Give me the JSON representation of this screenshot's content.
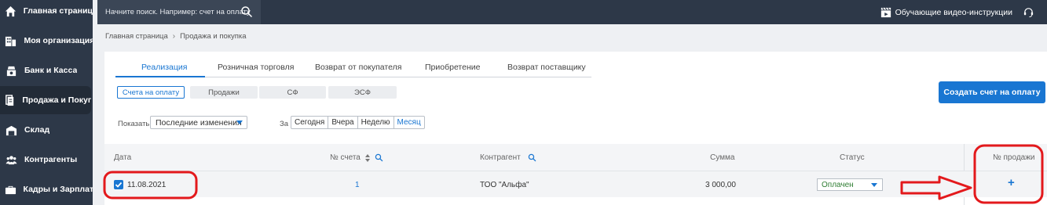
{
  "sidebar": {
    "items": [
      {
        "label": "Главная страница",
        "icon": "home-icon"
      },
      {
        "label": "Моя организация",
        "icon": "building-icon"
      },
      {
        "label": "Банк и Касса",
        "icon": "bank-icon"
      },
      {
        "label": "Продажа и Покупка",
        "icon": "documents-icon",
        "active": true
      },
      {
        "label": "Склад",
        "icon": "warehouse-icon"
      },
      {
        "label": "Контрагенты",
        "icon": "people-icon"
      },
      {
        "label": "Кадры и Зарплата",
        "icon": "briefcase-icon"
      }
    ]
  },
  "topbar": {
    "search_placeholder": "Начните поиск. Например: счет на оплату",
    "videos_label": "Обучающие видео-инструкции"
  },
  "breadcrumb": {
    "home": "Главная страница",
    "current": "Продажа и покупка"
  },
  "tabs": [
    {
      "label": "Реализация",
      "active": true
    },
    {
      "label": "Розничная торговля"
    },
    {
      "label": "Возврат от покупателя"
    },
    {
      "label": "Приобретение"
    },
    {
      "label": "Возврат поставщику"
    }
  ],
  "subtabs": [
    {
      "label": "Счета на оплату",
      "active": true
    },
    {
      "label": "Продажи"
    },
    {
      "label": "СФ"
    },
    {
      "label": "ЭСФ"
    }
  ],
  "create_button": "Создать счет на оплату",
  "filter": {
    "show_label": "Показать",
    "show_value": "Последние изменения",
    "period_label": "За",
    "period_options": [
      "Сегодня",
      "Вчера",
      "Неделю",
      "Месяц"
    ],
    "period_selected": "Месяц"
  },
  "table": {
    "headers": {
      "date": "Дата",
      "number": "№ счета",
      "counterparty": "Контрагент",
      "amount": "Сумма",
      "status": "Статус",
      "sale_no": "№ продажи"
    },
    "rows": [
      {
        "checked": true,
        "date": "11.08.2021",
        "number": "1",
        "counterparty": "ТОО \"Альфа\"",
        "amount": "3 000,00",
        "status": "Оплачен",
        "sale_action": "+"
      }
    ]
  },
  "colors": {
    "sidebar": "#2d3848",
    "accent": "#1976d2",
    "annotation": "#e3191c",
    "status_paid": "#2e7d32"
  }
}
